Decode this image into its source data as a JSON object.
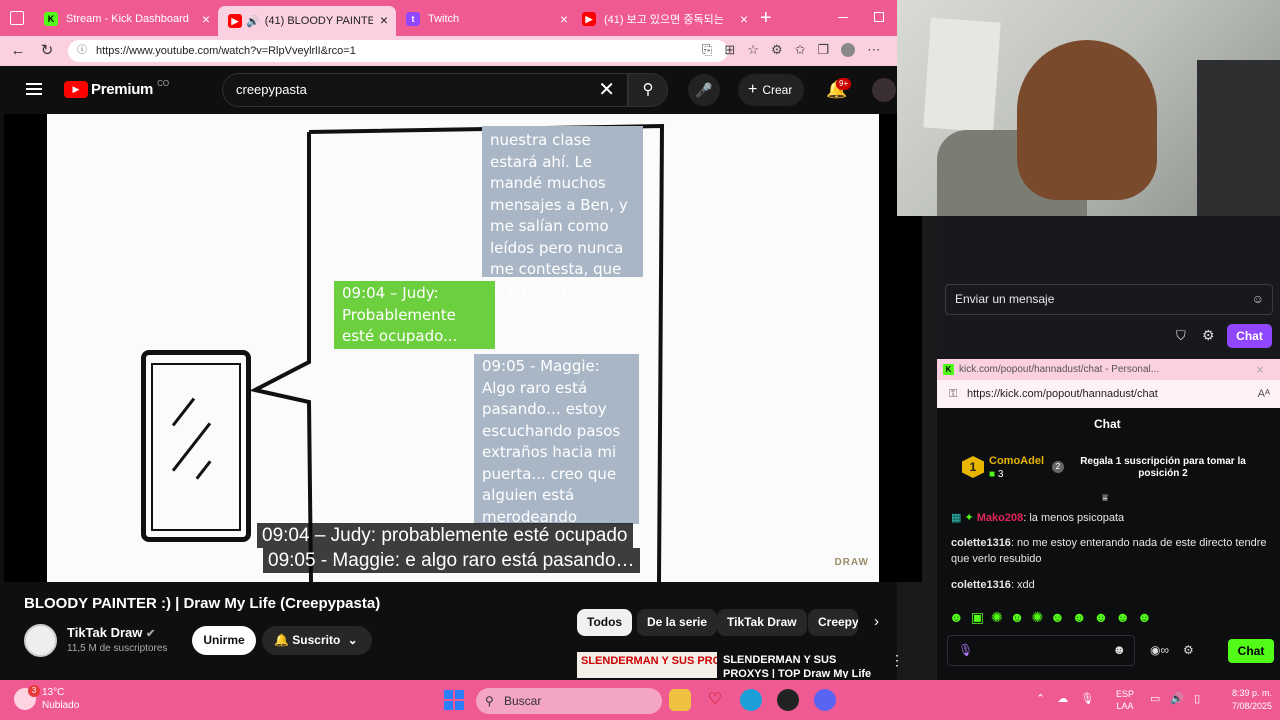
{
  "browser": {
    "tabs": [
      {
        "title": "Stream - Kick Dashboard",
        "icon": "kick-icon"
      },
      {
        "title": "(41) BLOODY PAINTER :)",
        "icon": "youtube-icon"
      },
      {
        "title": "Twitch",
        "icon": "twitch-icon"
      },
      {
        "title": "(41) 보고 있으면 중독되는",
        "icon": "youtube-icon"
      }
    ],
    "url": "https://www.youtube.com/watch?v=RlpVveylrlI&rco=1"
  },
  "youtube": {
    "logo_text": "Premium",
    "country_code": "CO",
    "search_value": "creepypasta",
    "create_label": "Crear",
    "notification_count": "9+",
    "video": {
      "bubbles": {
        "maggie_top": "nuestra clase estará ahí. Le mandé muchos mensajes a Ben, y me salían como leídos pero nunca me contesta, que le pasará?",
        "judy": "09:04 – Judy: Probablemente esté ocupado...",
        "maggie_bottom": "09:05 - Maggie: Algo raro está pasando… estoy escuchando pasos extraños hacia mi puerta... creo que alguien está merodeando"
      },
      "subtitles": [
        "09:04 – Judy: probablemente esté ocupado",
        "09:05 - Maggie: e algo raro está pasando…"
      ],
      "watermark": "DRAW"
    },
    "title": "BLOODY PAINTER :) | Draw My Life (Creepypasta)",
    "channel": {
      "name": "TikTak Draw",
      "subscribers": "11,5 M de suscriptores"
    },
    "join_label": "Unirme",
    "subscribed_label": "Suscrito",
    "chips": [
      "Todos",
      "De la serie",
      "TikTak Draw",
      "Creepy"
    ],
    "recommended": {
      "title": "SLENDERMAN Y SUS PROXYS | TOP Draw My Life",
      "thumb_text": "SLENDERMAN Y SUS PROXYS"
    }
  },
  "stream_chat": {
    "placeholder": "Enviar un mensaje",
    "chat_label": "Chat"
  },
  "popup": {
    "title": "kick.com/popout/hannadust/chat - Personal...",
    "url": "https://kick.com/popout/hannadust/chat",
    "header": "Chat",
    "leader": {
      "rank": "1",
      "name": "ComoAdel",
      "count": "3",
      "next_rank": "2",
      "message": "Regala 1 suscripción para tomar la posición 2"
    },
    "messages": [
      {
        "user": "Mako208",
        "text": ": la menos psicopata",
        "color": "#e0265a"
      },
      {
        "user": "colette1316",
        "text": ": no me estoy enterando nada de este directo tendre que verlo resubido",
        "color": "#f2f2f2"
      },
      {
        "user": "colette1316",
        "text": ": xdd",
        "color": "#f2f2f2"
      }
    ],
    "chat_button": "Chat"
  },
  "taskbar": {
    "weather": {
      "temp": "13°C",
      "desc": "Nublado",
      "badge": "3"
    },
    "search_label": "Buscar",
    "lang": {
      "top": "ESP",
      "bottom": "LAA"
    },
    "time": "8:39 p. m.",
    "date": "7/08/2025"
  },
  "colors": {
    "accent_pink": "#ef5a92",
    "kick_green": "#53fc18",
    "twitch_purple": "#9146ff",
    "youtube_red": "#ff0000"
  }
}
